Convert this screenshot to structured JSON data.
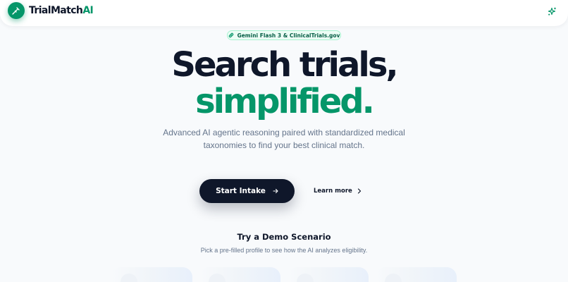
{
  "header": {
    "logo_icon": "stethoscope-logo-icon",
    "brand_part1": "TrialMatch",
    "brand_part2": "AI",
    "sparkle_icon": "sparkles-icon"
  },
  "badge": {
    "icon": "pill-icon",
    "text": "Gemini Flash 3 & ClinicalTrials.gov"
  },
  "hero": {
    "headline_line1": "Search trials,",
    "headline_line2": "simplified.",
    "subtitle": "Advanced AI agentic reasoning paired with standardized medical taxonomies to find your best clinical match."
  },
  "cta": {
    "primary_label": "Start Intake",
    "primary_icon": "arrow-right-icon",
    "secondary_label": "Learn more",
    "secondary_icon": "chevron-right-icon"
  },
  "demo": {
    "title": "Try a Demo Scenario",
    "subtitle": "Pick a pre-filled profile to see how the AI analyzes eligibility."
  },
  "colors": {
    "accent": "#059669",
    "dark": "#0f172a",
    "muted": "#64748b",
    "background": "#f8fafc"
  }
}
